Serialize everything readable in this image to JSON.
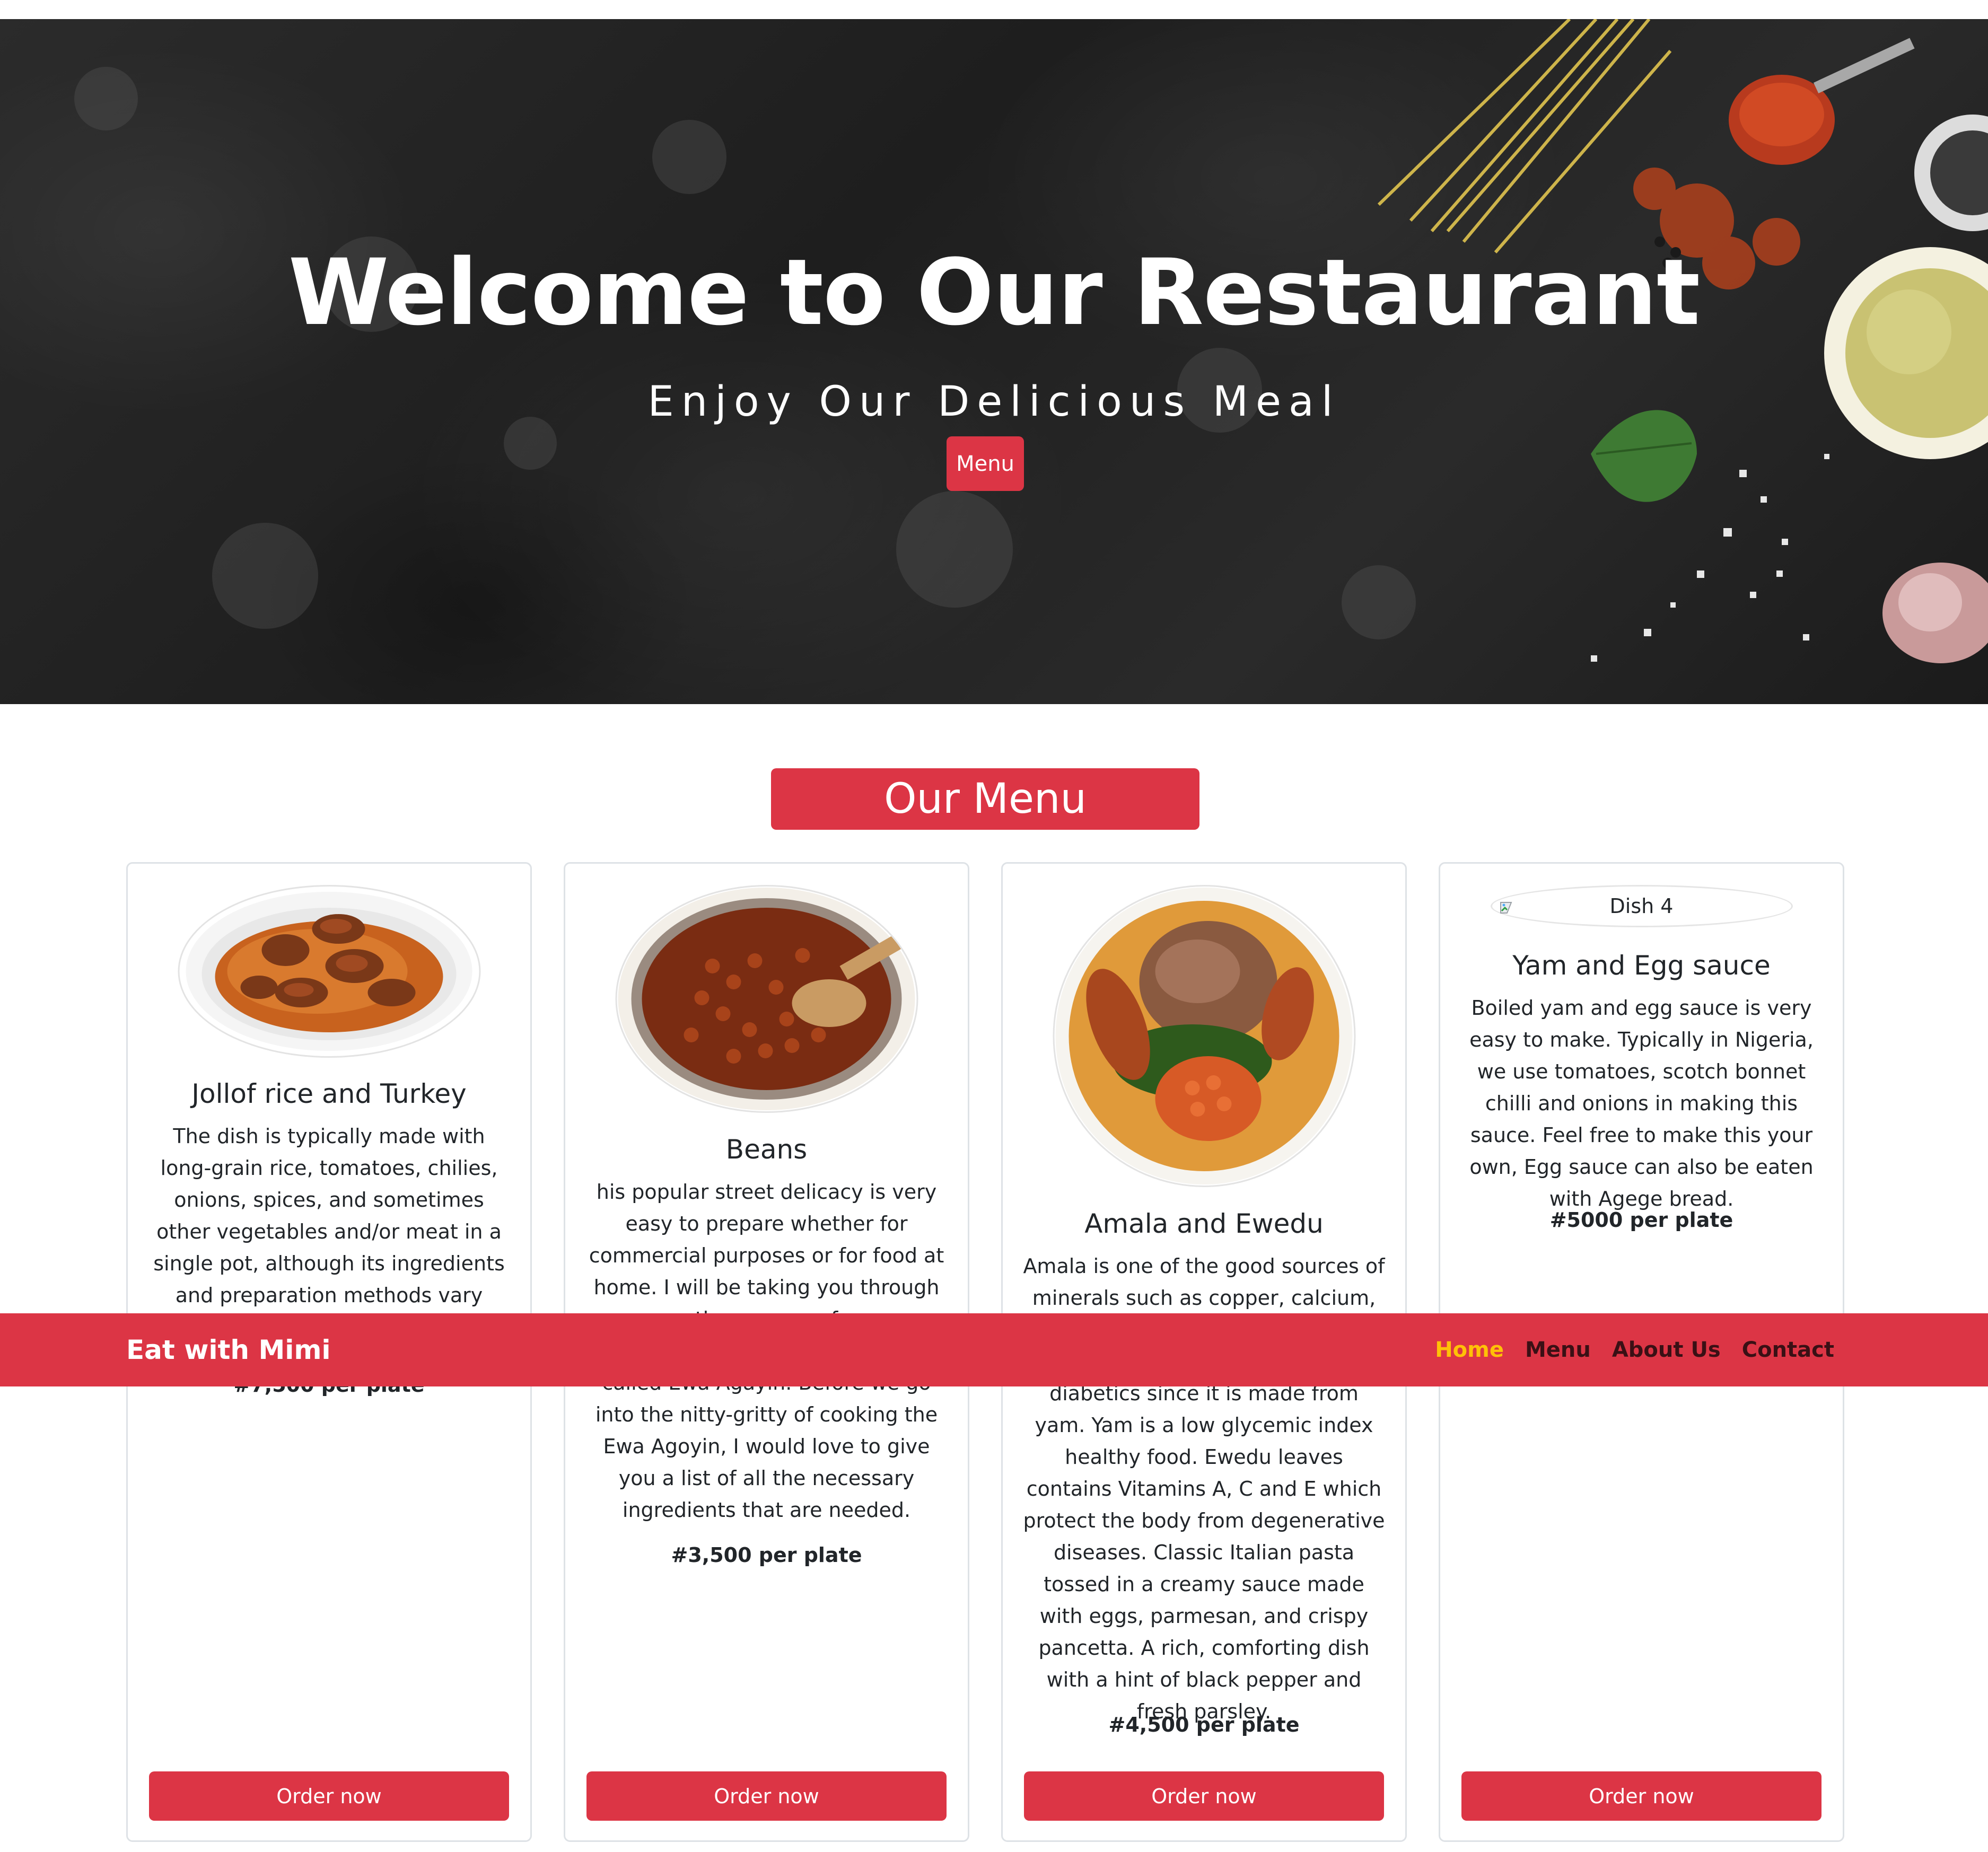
{
  "hero": {
    "title": "Welcome to Our Restaurant",
    "subtitle": "Enjoy Our Delicious Meal",
    "menu_button": "Menu"
  },
  "menu_section": {
    "heading": "Our Menu"
  },
  "cards": [
    {
      "title": "Jollof rice and Turkey",
      "description": "The dish is typically made with long-grain rice, tomatoes, chilies, onions, spices, and sometimes other vegetables and/or meat in a single pot, although its ingredients and preparation methods vary across",
      "price": "#7,500 per plate",
      "button": "Order now",
      "image_icon": "jollof-rice-image"
    },
    {
      "title": "Beans",
      "description_top": "his popular street delicacy is very easy to prepare whether for commercial purposes or for food at home. I will be taking you through the process of",
      "description_bottom": "called Ewa Agayin. Before we go into the nitty-gritty of cooking the Ewa Agoyin, I would love to give you a list of all the necessary ingredients that are needed.",
      "price": "#3,500 per plate",
      "button": "Order now",
      "image_icon": "beans-image"
    },
    {
      "title": "Amala and Ewedu",
      "description_top": "Amala is one of the good sources of minerals such as copper, calcium,",
      "description_bottom": "diabetics since it is made from yam. Yam is a low glycemic index healthy food. Ewedu leaves contains Vitamins A, C and E which protect the body from degenerative diseases. Classic Italian pasta tossed in a creamy sauce made with eggs, parmesan, and crispy pancetta. A rich, comforting dish with a hint of black pepper and fresh parsley.",
      "price": "#4,500 per plate",
      "button": "Order now",
      "image_icon": "amala-ewedu-image"
    },
    {
      "image_alt": "Dish 4",
      "title": "Yam and Egg sauce",
      "description": "Boiled yam and egg sauce is very easy to make. Typically in Nigeria, we use tomatoes, scotch bonnet chilli and onions in making this sauce. Feel free to make this your own, Egg sauce can also be eaten with Agege bread.",
      "price": "#5000 per plate",
      "button": "Order now",
      "image_icon": "broken-image-icon"
    }
  ],
  "navbar": {
    "brand": "Eat with Mimi",
    "links": [
      "Home",
      "Menu",
      "About Us",
      "Contact"
    ],
    "active_link": "Home",
    "colors": {
      "background": "#dc3545",
      "active": "#ffc107",
      "link": "#3a1015"
    }
  },
  "colors": {
    "accent": "#dc3545",
    "hero_background": "#222222"
  }
}
